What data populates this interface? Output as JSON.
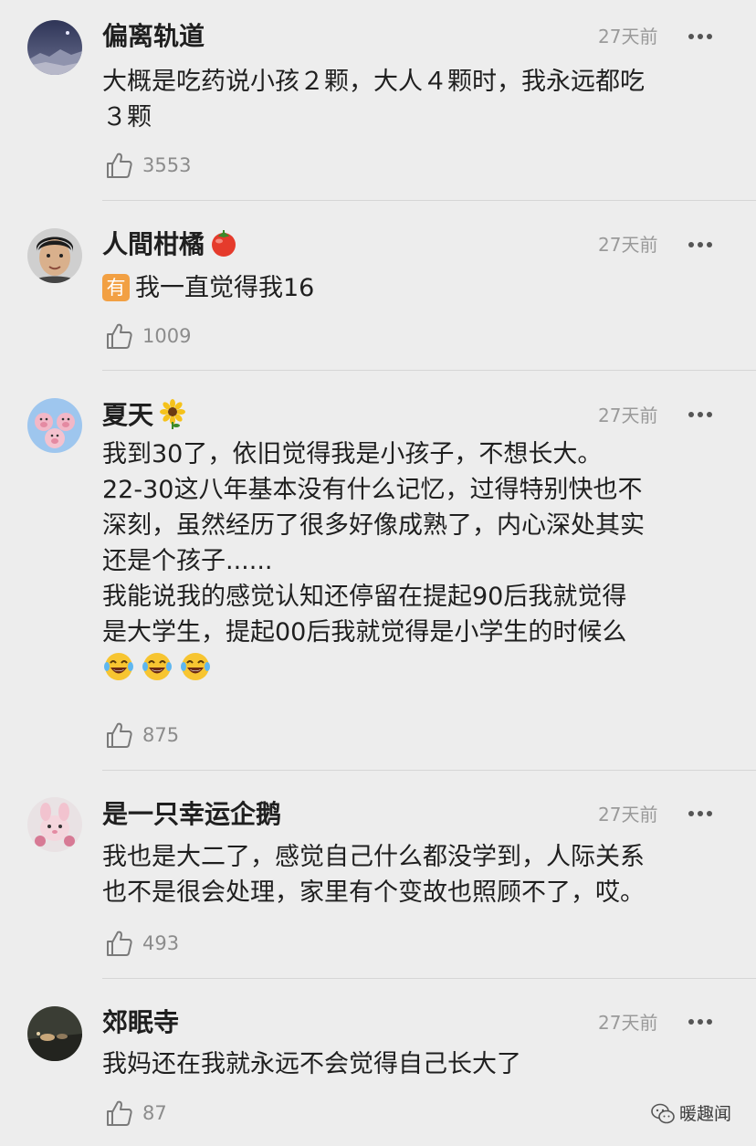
{
  "comments": [
    {
      "name": "偏离轨道",
      "time": "27天前",
      "text": [
        "大概是吃药说小孩２颗，大人４颗时，我永远都吃",
        "３颗"
      ],
      "likes": "3553",
      "avatar_icon": "night-landscape-avatar"
    },
    {
      "name": "人間柑橘",
      "name_emoji": "tomato-icon",
      "time": "27天前",
      "badge": "有",
      "text": [
        "我一直觉得我16"
      ],
      "likes": "1009",
      "avatar_icon": "person-face-avatar"
    },
    {
      "name": "夏天",
      "name_emoji": "sunflower-icon",
      "time": "27天前",
      "text": [
        "我到30了，依旧觉得我是小孩子，不想长大。",
        "22-30这八年基本没有什么记忆，过得特别快也不",
        "深刻，虽然经历了很多好像成熟了，内心深处其实",
        "还是个孩子......",
        "我能说我的感觉认知还停留在提起90后我就觉得",
        "是大学生，提起00后我就觉得是小学生的时候么"
      ],
      "laugh_emojis": [
        "tears-of-joy-icon",
        "tears-of-joy-icon",
        "tears-of-joy-icon"
      ],
      "likes": "875",
      "avatar_icon": "pink-pigs-avatar"
    },
    {
      "name": "是一只幸运企鹅",
      "time": "27天前",
      "text": [
        "我也是大二了，感觉自己什么都没学到，人际关系",
        "也不是很会处理，家里有个变故也照顾不了，哎。"
      ],
      "likes": "493",
      "avatar_icon": "plush-toy-avatar"
    },
    {
      "name": "郊眠寺",
      "time": "27天前",
      "text": [
        "我妈还在我就永远不会觉得自己长大了"
      ],
      "likes": "87",
      "avatar_icon": "dark-scene-avatar"
    }
  ],
  "watermark": {
    "text": "暖趣闻",
    "icon": "wechat-icon"
  },
  "colors": {
    "background": "#ededed",
    "name_text": "#1f1f1f",
    "time_text": "#9a9a9a",
    "like_count": "#8c8c8c",
    "divider": "#d6d6d6",
    "badge_bg": "#f2a043"
  }
}
